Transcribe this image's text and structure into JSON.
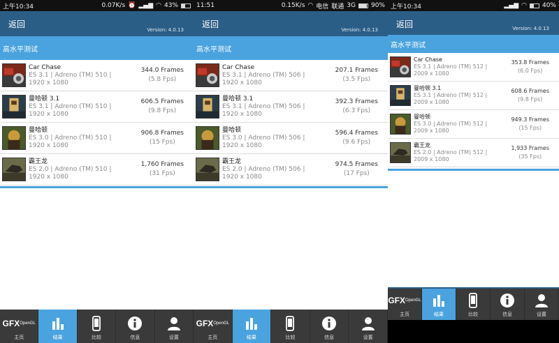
{
  "screens": [
    {
      "status": {
        "left": "上午10:34",
        "speed": "0.07K/s",
        "battery": "43%",
        "battery_level": 0.43
      },
      "back": "返回",
      "version": "Version: 4.0.13",
      "section": "高水平测试",
      "rows": [
        {
          "name": "Car Chase",
          "api": "ES 3.1 | Adreno (TM) 510 |",
          "res": "1920 x 1080",
          "frames": "344.0 Frames",
          "fps": "(5.8 Fps)",
          "thumb": "car"
        },
        {
          "name": "曼哈顿 3.1",
          "api": "ES 3.1 | Adreno (TM) 510 |",
          "res": "1920 x 1080",
          "frames": "606.5 Frames",
          "fps": "(9.8 Fps)",
          "thumb": "manhattan31"
        },
        {
          "name": "曼哈顿",
          "api": "ES 3.0 | Adreno (TM) 510 |",
          "res": "1920 x 1080",
          "frames": "906.8 Frames",
          "fps": "(15 Fps)",
          "thumb": "manhattan"
        },
        {
          "name": "霸王龙",
          "api": "ES 2.0 | Adreno (TM) 510 |",
          "res": "1920 x 1080",
          "frames": "1,760 Frames",
          "fps": "(31 Fps)",
          "thumb": "trex"
        }
      ]
    },
    {
      "status": {
        "left": "11:51",
        "speed": "0.15K/s",
        "carrier1": "电信",
        "carrier2": "联通",
        "net": "3G",
        "battery": "90%",
        "battery_level": 0.9
      },
      "back": "返回",
      "version": "Version: 4.0.13",
      "section": "高水平测试",
      "rows": [
        {
          "name": "Car Chase",
          "api": "ES 3.1 | Adreno (TM) 506 |",
          "res": "1920 x 1080",
          "frames": "207.1 Frames",
          "fps": "(3.5 Fps)",
          "thumb": "car"
        },
        {
          "name": "曼哈顿 3.1",
          "api": "ES 3.1 | Adreno (TM) 506 |",
          "res": "1920 x 1080",
          "frames": "392.3 Frames",
          "fps": "(6.3 Fps)",
          "thumb": "manhattan31"
        },
        {
          "name": "曼哈顿",
          "api": "ES 3.0 | Adreno (TM) 506 |",
          "res": "1920 x 1080",
          "frames": "596.4 Frames",
          "fps": "(9.6 Fps)",
          "thumb": "manhattan"
        },
        {
          "name": "霸王龙",
          "api": "ES 2.0 | Adreno (TM) 506 |",
          "res": "1920 x 1080",
          "frames": "974.5 Frames",
          "fps": "(17 Fps)",
          "thumb": "trex"
        }
      ]
    },
    {
      "status": {
        "left": "上午10:34",
        "battery": "40%",
        "battery_level": 0.4
      },
      "back": "返回",
      "version": "Version: 4.0.13",
      "section": "高水平测试",
      "rows": [
        {
          "name": "Car Chase",
          "api": "ES 3.1 | Adreno (TM) 512 |",
          "res": "2009 x 1080",
          "frames": "353.8 Frames",
          "fps": "(6.0 Fps)",
          "thumb": "car"
        },
        {
          "name": "曼哈顿 3.1",
          "api": "ES 3.1 | Adreno (TM) 512 |",
          "res": "2009 x 1080",
          "frames": "608.6 Frames",
          "fps": "(9.8 Fps)",
          "thumb": "manhattan31"
        },
        {
          "name": "曼哈顿",
          "api": "ES 3.0 | Adreno (TM) 512 |",
          "res": "2009 x 1080",
          "frames": "949.3 Frames",
          "fps": "(15 Fps)",
          "thumb": "manhattan"
        },
        {
          "name": "霸王龙",
          "api": "ES 2.0 | Adreno (TM) 512 |",
          "res": "2009 x 1080",
          "frames": "1,933 Frames",
          "fps": "(35 Fps)",
          "thumb": "trex"
        }
      ]
    }
  ],
  "tabs": [
    {
      "label": "主页",
      "icon": "gfx-logo",
      "logo_text": "GFX",
      "logo_sub": "OpenGL"
    },
    {
      "label": "结果",
      "icon": "bar-chart-icon",
      "active": true
    },
    {
      "label": "比较",
      "icon": "phone-icon"
    },
    {
      "label": "信息",
      "icon": "info-icon"
    },
    {
      "label": "设置",
      "icon": "user-icon"
    }
  ],
  "colors": {
    "header": "#2b5e87",
    "accent": "#4aa3de",
    "tabbar": "#3a3a3a"
  }
}
